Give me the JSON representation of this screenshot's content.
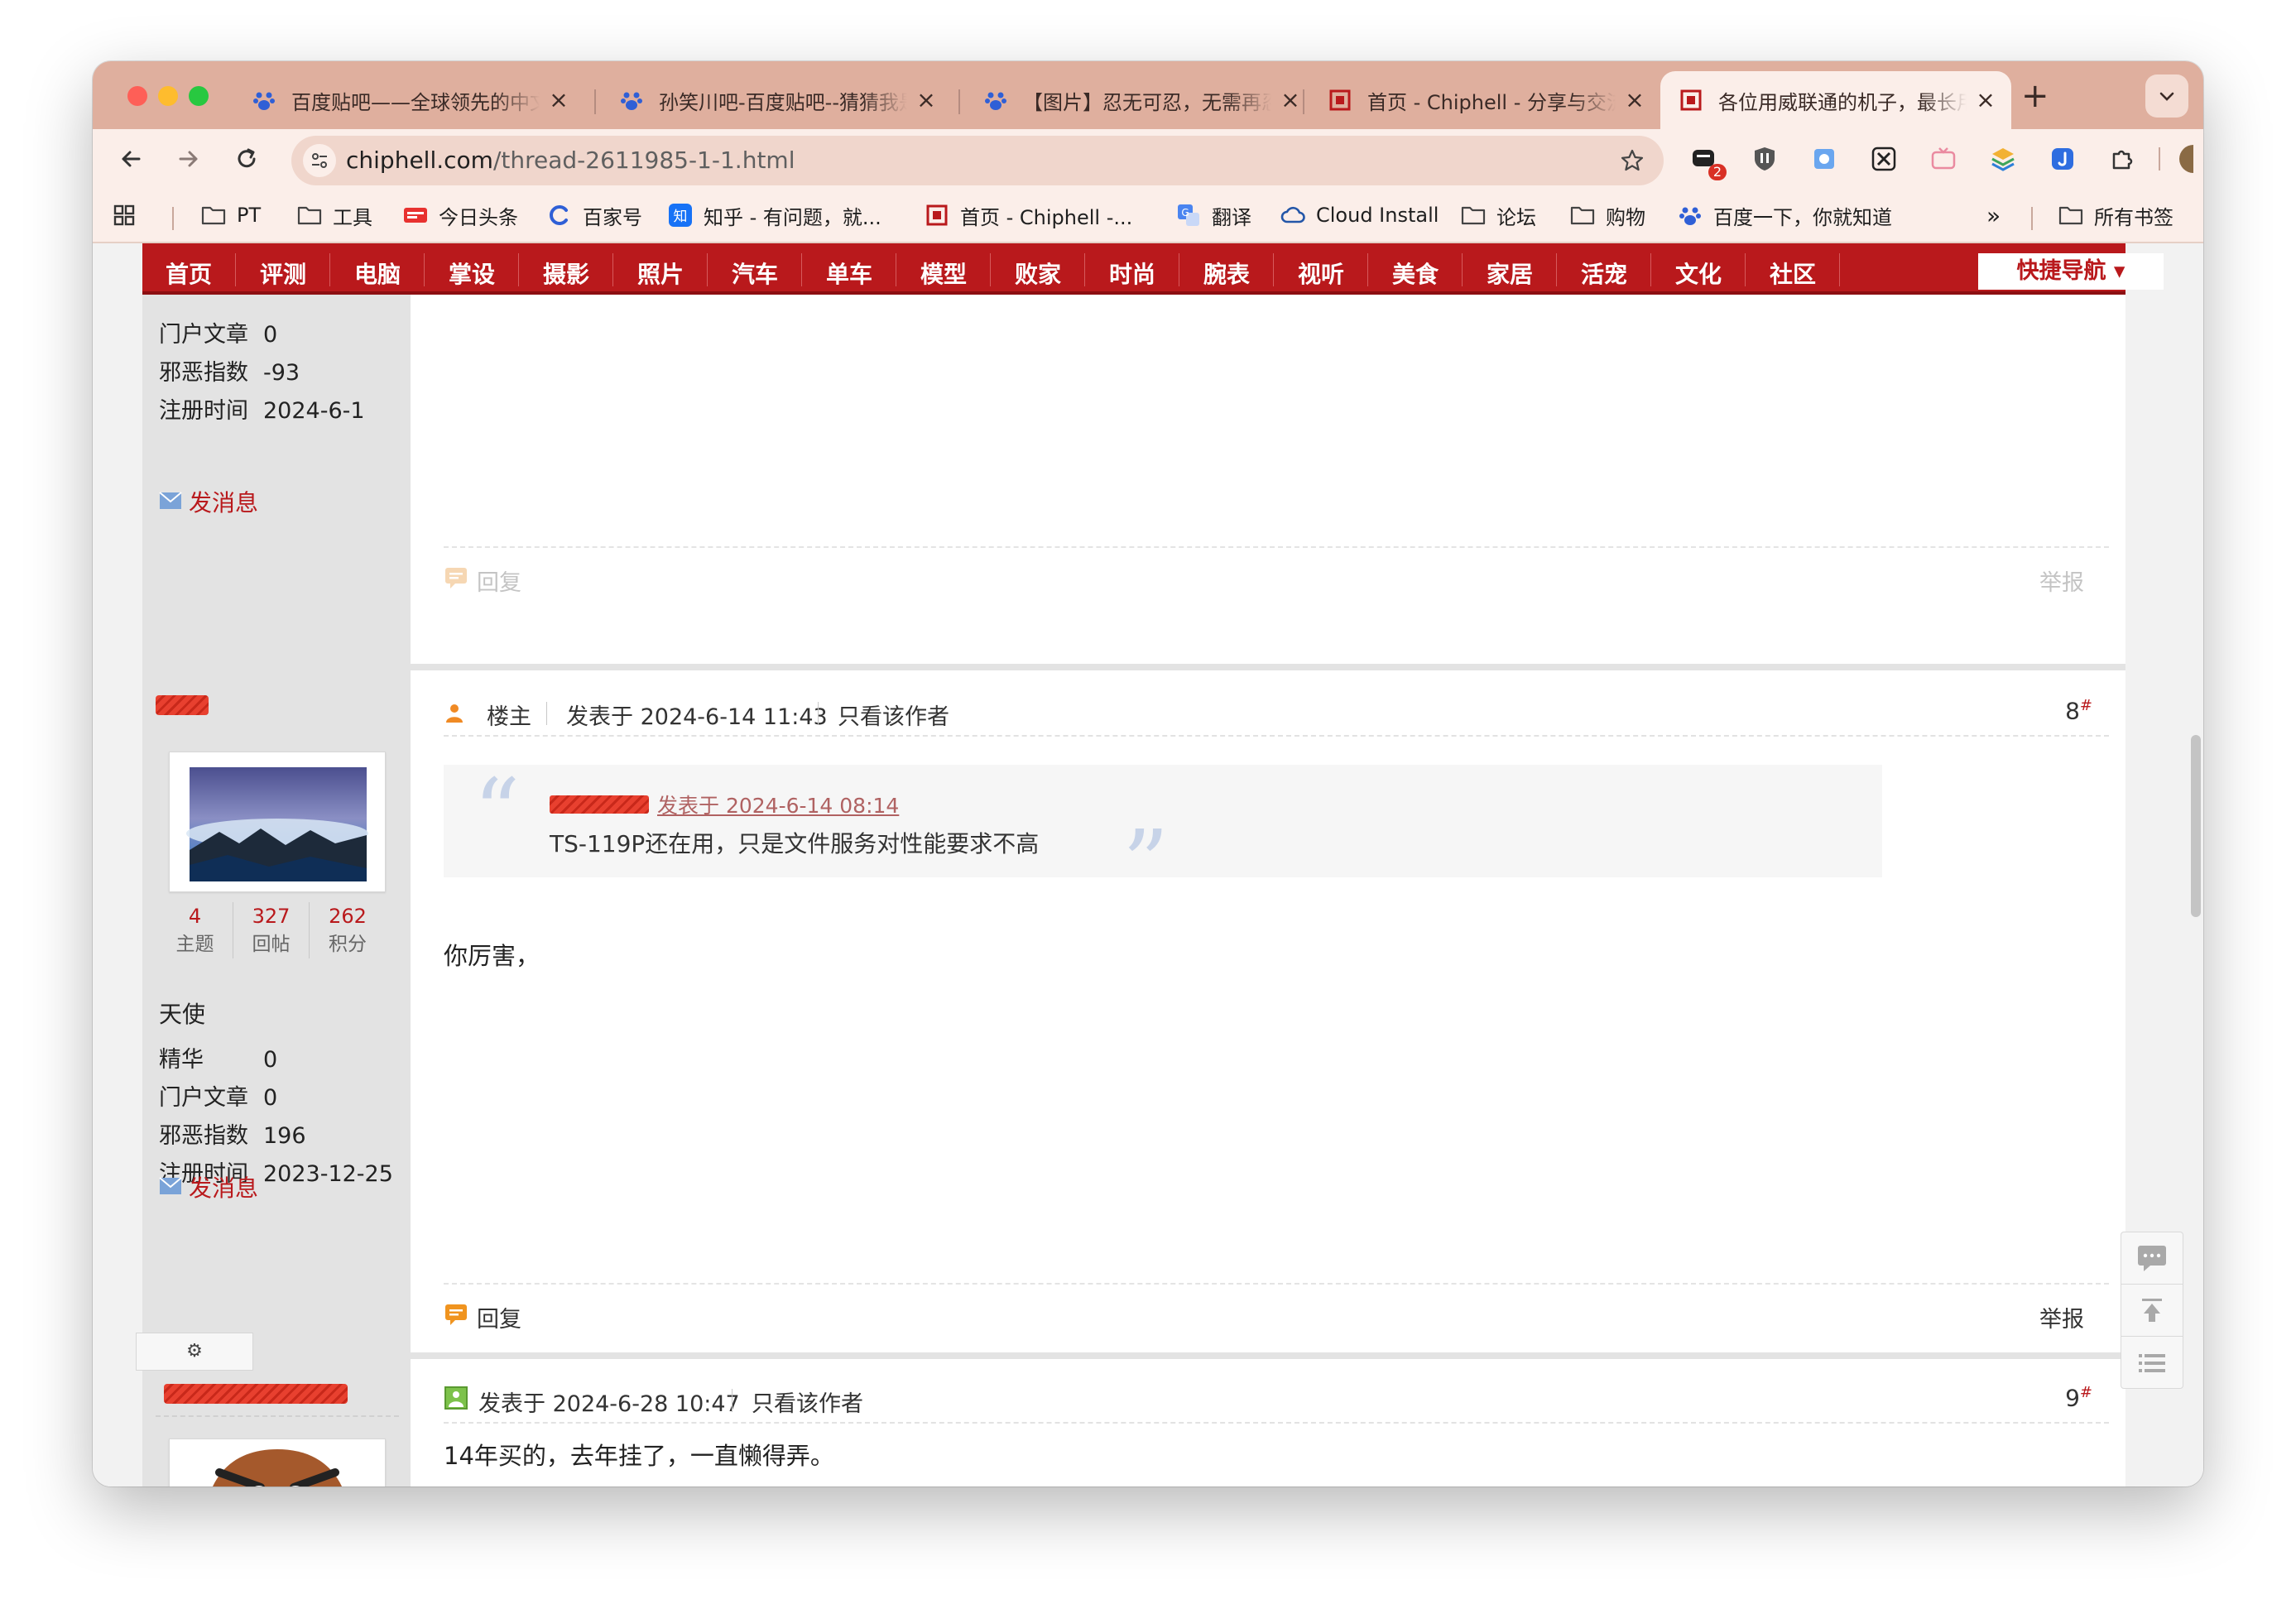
{
  "browser": {
    "tabs": [
      {
        "title": "百度贴吧——全球领先的中文社区",
        "icon": "baidu-paw-icon"
      },
      {
        "title": "孙笑川吧-百度贴吧--猜猜我是谁",
        "icon": "baidu-paw-icon"
      },
      {
        "title": "【图片】忍无可忍，无需再忍",
        "icon": "baidu-paw-icon"
      },
      {
        "title": "首页 - Chiphell - 分享与交流",
        "icon": "chiphell-icon"
      },
      {
        "title": "各位用威联通的机子，最长用了多久",
        "icon": "chiphell-icon",
        "active": true
      }
    ],
    "url_host": "chiphell.com",
    "url_path": "/thread-2611985-1-1.html",
    "extension_badge": "2",
    "bookmarks": [
      {
        "label": "PT",
        "icon": "folder-icon"
      },
      {
        "label": "工具",
        "icon": "folder-icon"
      },
      {
        "label": "今日头条",
        "icon": "toutiao-icon"
      },
      {
        "label": "百家号",
        "icon": "baijiahao-icon"
      },
      {
        "label": "知乎 - 有问题，就...",
        "icon": "zhihu-icon"
      },
      {
        "label": "首页 - Chiphell -...",
        "icon": "chiphell-icon"
      },
      {
        "label": "翻译",
        "icon": "translate-icon"
      },
      {
        "label": "Cloud Install",
        "icon": "cloud-icon"
      },
      {
        "label": "论坛",
        "icon": "folder-icon"
      },
      {
        "label": "购物",
        "icon": "folder-icon"
      },
      {
        "label": "百度一下，你就知道",
        "icon": "baidu-paw-icon"
      }
    ],
    "bookmarks_more": "»",
    "all_bookmarks": "所有书签"
  },
  "nav": {
    "items": [
      "首页",
      "评测",
      "电脑",
      "掌设",
      "摄影",
      "照片",
      "汽车",
      "单车",
      "模型",
      "败家",
      "时尚",
      "腕表",
      "视听",
      "美食",
      "家居",
      "活宠",
      "文化",
      "社区"
    ],
    "quick_nav": "快捷导航"
  },
  "post_prev": {
    "profile": [
      {
        "key": "门户文章",
        "value": "0"
      },
      {
        "key": "邪恶指数",
        "value": "-93"
      },
      {
        "key": "注册时间",
        "value": "2024-6-1"
      }
    ],
    "send_message": "发消息",
    "reply": "回复",
    "report": "举报"
  },
  "post_8": {
    "counts": [
      {
        "num": "4",
        "label": "主题"
      },
      {
        "num": "327",
        "label": "回帖"
      },
      {
        "num": "262",
        "label": "积分"
      }
    ],
    "rank": "天使",
    "profile": [
      {
        "key": "精华",
        "value": "0"
      },
      {
        "key": "门户文章",
        "value": "0"
      },
      {
        "key": "邪恶指数",
        "value": "196"
      },
      {
        "key": "注册时间",
        "value": "2023-12-25"
      }
    ],
    "send_message": "发消息",
    "op_label": "楼主",
    "posted_at": "发表于 2024-6-14 11:43",
    "only_author": "只看该作者",
    "floor": "8",
    "floor_mark": "#",
    "quote_meta": "发表于 2024-6-14 08:14",
    "quote_text": "TS-119P还在用，只是文件服务对性能要求不高",
    "body": "你厉害，",
    "reply": "回复",
    "report": "举报"
  },
  "post_9": {
    "posted_at": "发表于 2024-6-28 10:47",
    "only_author": "只看该作者",
    "floor": "9",
    "floor_mark": "#",
    "body": "14年买的，去年挂了，一直懒得弄。"
  },
  "settings_glyph": "⚙",
  "colors": {
    "tab_strip": "#dfaf9e",
    "nav_red": "#b9191c",
    "link_red": "#b9191c",
    "sidebar_gray": "#e3e3e3"
  }
}
